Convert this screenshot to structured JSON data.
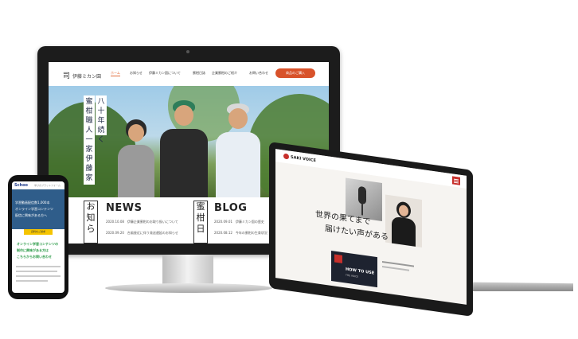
{
  "monitor": {
    "logo_mark": "司",
    "logo_text": "伊藤ミカン園",
    "nav": [
      "ホーム",
      "お知らせ",
      "伊藤ミカン園について",
      "蜜柑日誌",
      "企業蜜柑のご紹介",
      "お問い合わせ"
    ],
    "cta": "商品のご購入",
    "hero_title_1": "八十年続く",
    "hero_title_2": "蜜柑職人一家 伊藤家",
    "news_vertical": "お知ら",
    "news_title": "NEWS",
    "news_items": [
      "2020.10.08　伊藤企業蜜柑のお取り扱いについて",
      "2020.09.20　台風接近に伴う発送遅延のお知らせ"
    ],
    "blog_vertical": "蜜柑日",
    "blog_title": "BLOG",
    "blog_items": [
      "2020.09.01　伊藤ミカン園の歴史",
      "2020.08.12　今年の蜜柑の生育状況"
    ]
  },
  "laptop": {
    "logo": "SAKI VOICE",
    "headline_1": "世界の果てまで",
    "headline_2": "届けたい声がある",
    "video_caption": "HOW TO USE",
    "video_sub": "THE VOICE"
  },
  "phone": {
    "logo": "Schoo",
    "tagline": "学びのプラットフォーム",
    "hero_lines": [
      "学習動画配信数1,000本",
      "オンライン学習コンテンツ",
      "配信に興味がある方へ"
    ],
    "button": "資料をご請求",
    "green_lines": [
      "オンライン学習コンテンツの",
      "制作に興味がある方は",
      "こちらからお問い合わせ"
    ]
  },
  "colors": {
    "accent": "#d8522a",
    "laptop_red": "#c7302c",
    "phone_blue": "#2f5d8a"
  }
}
